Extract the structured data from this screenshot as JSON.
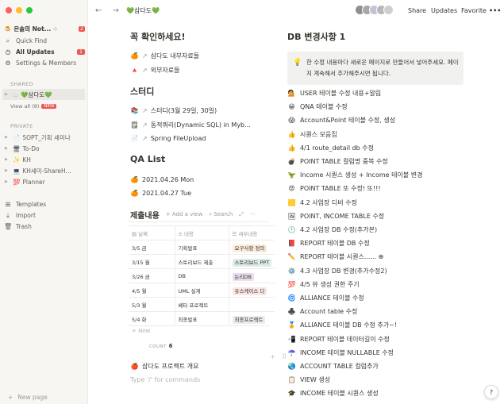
{
  "sidebar": {
    "workspace": "은솔의 Not...",
    "workspace_caret": "◇",
    "workspace_badge": "2",
    "quick_find": "Quick Find",
    "all_updates": "All Updates",
    "all_updates_badge": "1",
    "settings": "Settings & Members",
    "shared_label": "SHARED",
    "shared_page": "💚삼다도💚",
    "view_all": "View all (8)",
    "view_all_badge": "NEW",
    "private_label": "PRIVATE",
    "private_pages": [
      {
        "icon": "📄",
        "label": "SOPT_기획 세미나"
      },
      {
        "icon": "🖥",
        "label": "To-Do"
      },
      {
        "icon": "✨",
        "label": "KH"
      },
      {
        "icon": "💻",
        "label": "KH세미-ShareH..."
      },
      {
        "icon": "💯",
        "label": "Planner"
      }
    ],
    "templates": "Templates",
    "import": "Import",
    "trash": "Trash",
    "new_page": "New page"
  },
  "topbar": {
    "back_forward": "← →",
    "breadcrumb": "💚삼다도💚",
    "share": "Share",
    "updates": "Updates",
    "favorite": "Favorite",
    "more": "•••"
  },
  "left": {
    "h_check": "꼭 확인하세요!",
    "check_items": [
      {
        "icon": "🍊",
        "text": "삼다도 내부자료들"
      },
      {
        "icon": "🔺",
        "text": "외부자료들"
      }
    ],
    "h_study": "스터디",
    "study_items": [
      {
        "icon": "📚",
        "text": "스터디(3월 29일, 30일)"
      },
      {
        "icon": "🗒",
        "text": "동적쿼리(Dynamic SQL) in Myb..."
      },
      {
        "icon": "📄",
        "text": "Spring FileUpload"
      }
    ],
    "h_qa": "QA List",
    "qa_items": [
      {
        "icon": "🍊",
        "text": "2021.04.26 Mon"
      },
      {
        "icon": "🍊",
        "text": "2021.04.27 Tue"
      }
    ],
    "db_title": "제출내용",
    "add_view": "+ Add a view",
    "search": "Search",
    "expand": "⤢",
    "more": "···",
    "columns": [
      "날짜",
      "내용",
      "세부내용"
    ],
    "rows": [
      {
        "date": "3/5 금",
        "content": "기획발표",
        "detail": "요구사항 정의",
        "color": "#fbecdd"
      },
      {
        "date": "3/15 월",
        "content": "스토리보드 제출",
        "detail": "스토리보드 PPT",
        "color": "#ddedea"
      },
      {
        "date": "3/26 금",
        "content": "DB",
        "detail": "논리DB",
        "color": "#e8deee"
      },
      {
        "date": "4/5 월",
        "content": "UML 설계",
        "detail": "유스케이스 다",
        "color": "#fbe4e4"
      },
      {
        "date": "5/3 월",
        "content": "베타 프로젝트",
        "detail": "",
        "color": "#ffffff"
      },
      {
        "date": "5/4 화",
        "content": "최종발표",
        "detail": "최종프로젝트",
        "color": "#ebeced"
      }
    ],
    "new_row": "+ New",
    "count_label": "COUNT",
    "count_value": "6",
    "overview": "삼다도 프로젝트 개요",
    "overview_icon": "🍎",
    "type_hint": "Type '/' for commands"
  },
  "right": {
    "title": "DB 변경사항 1",
    "callout": "한 수정 내용마다 새로운 페이지로 만들어서 넣어주세요. 페이지 계속해서 추가해주시면 됩니다.",
    "items": [
      {
        "icon": "💁",
        "text": "USER 테이블 수정 내용+알림"
      },
      {
        "icon": "😀",
        "text": "QNA 테이블 수정"
      },
      {
        "icon": "😱",
        "text": "Account&Point 테이블 수정, 생성"
      },
      {
        "icon": "👍",
        "text": "시퀀스 모음집"
      },
      {
        "icon": "👍",
        "text": "4/1 route_detail db 수정"
      },
      {
        "icon": "💣",
        "text": "POINT TABLE 컬럼명 중복 수정"
      },
      {
        "icon": "🦖",
        "text": "Income 시퀀스 생성 + Income 테이블 변경"
      },
      {
        "icon": "😡",
        "text": "POINT TABLE 또 수정! 또!!!"
      },
      {
        "icon": "🟨",
        "text": "4.2 사업장 디비 수정"
      },
      {
        "icon": "🖼",
        "text": "POINT, INCOME TABLE 수정"
      },
      {
        "icon": "🕐",
        "text": "4.2 사업장 DB 수정(추가본)"
      },
      {
        "icon": "📕",
        "text": "REPORT 테이블 DB 수정"
      },
      {
        "icon": "✏️",
        "text": "REPORT 테이블 시퀀스...... ⊕"
      },
      {
        "icon": "⚙️",
        "text": "4.3 사업장 DB 변경(추가수정2)"
      },
      {
        "icon": "💯",
        "text": "4/5 뷰 생성 권한 주기"
      },
      {
        "icon": "🌀",
        "text": "ALLIANCE 테이블 수정"
      },
      {
        "icon": "♣️",
        "text": "Account table 수정"
      },
      {
        "icon": "🏅",
        "text": "ALLIANCE 테이블 DB 수정 추가~!"
      },
      {
        "icon": "📲",
        "text": "REPORT 테이블 데이터길이 수정"
      },
      {
        "icon": "☂️",
        "text": "INCOME 테이블 NULLABLE 수정"
      },
      {
        "icon": "🌏",
        "text": "ACCOUNT TABLE 컬럼추가"
      },
      {
        "icon": "📋",
        "text": "VIEW 생성"
      },
      {
        "icon": "🎓",
        "text": "INCOME 테이블 시퀀스 생성"
      }
    ]
  },
  "help": "?"
}
